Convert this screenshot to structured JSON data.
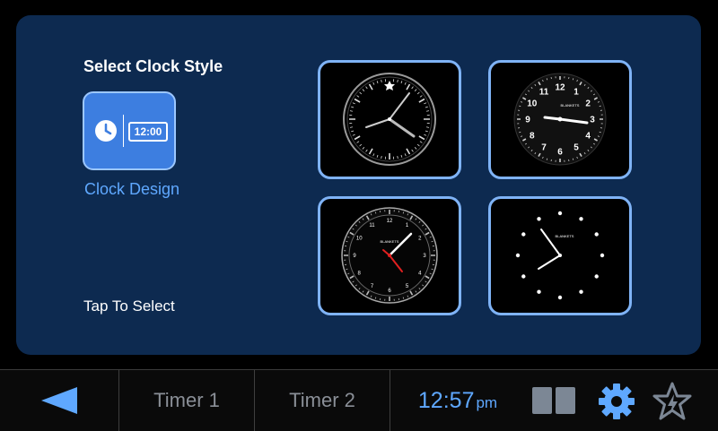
{
  "page": {
    "title": "Select Clock Style",
    "hint": "Tap To Select"
  },
  "design_option": {
    "label": "Clock Design",
    "digital_sample": "12:00",
    "icons": [
      "clock-face-icon",
      "digital-display-icon"
    ]
  },
  "clock_styles": [
    {
      "style": "analog-thin-ticks",
      "brand_text": "",
      "numerals": []
    },
    {
      "style": "analog-numerals",
      "brand_text": "BLANKETS",
      "numerals": [
        "12",
        "1",
        "2",
        "3",
        "4",
        "5",
        "6",
        "7",
        "8",
        "9",
        "10",
        "11"
      ]
    },
    {
      "style": "analog-bezel-red-seconds",
      "brand_text": "BLANKETS",
      "numerals": [
        "12",
        "1",
        "2",
        "3",
        "4",
        "5",
        "6",
        "7",
        "8",
        "9",
        "10",
        "11"
      ]
    },
    {
      "style": "analog-dots-minimal",
      "brand_text": "BLANKETS",
      "numerals": []
    }
  ],
  "taskbar": {
    "timer1_label": "Timer 1",
    "timer2_label": "Timer 2",
    "time": "12:57",
    "ampm": "pm",
    "icons": [
      "back-arrow-icon",
      "split-layout-icon",
      "gear-icon",
      "star-icon"
    ]
  },
  "colors": {
    "panel": "#0d2a50",
    "accent": "#5fa8ff",
    "tile": "#3d7ee0",
    "border": "#7fb3f6",
    "second_hand": "#e02020"
  }
}
